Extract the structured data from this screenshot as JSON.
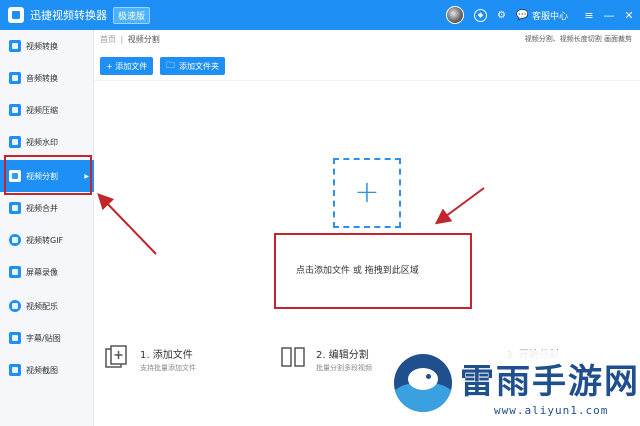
{
  "titlebar": {
    "app_title": "迅捷视频转换器",
    "edition_badge": "极速版",
    "service_label": "客服中心",
    "min_label": "—",
    "close_label": "✕"
  },
  "sidebar": {
    "items": [
      {
        "label": "视频转换"
      },
      {
        "label": "音频转换"
      },
      {
        "label": "视频压缩"
      },
      {
        "label": "视频水印"
      },
      {
        "label": "视频分割"
      },
      {
        "label": "视频合并"
      },
      {
        "label": "视频转GIF"
      },
      {
        "label": "屏幕录像"
      },
      {
        "label": "视频配乐"
      },
      {
        "label": "字幕/贴图"
      },
      {
        "label": "视频截图"
      }
    ],
    "active_index": 4
  },
  "breadcrumb": {
    "home": "首页",
    "sep": "|",
    "current": "视频分割"
  },
  "topright": "视频分割、视频长度切割 画面裁剪",
  "toolbar": {
    "add_file": "+ 添加文件",
    "add_folder": "添加文件夹"
  },
  "dropzone": {
    "hint": "点击添加文件 或 拖拽到此区域"
  },
  "steps": [
    {
      "title": "1. 添加文件",
      "desc": "支持批量添加文件"
    },
    {
      "title": "2. 编辑分割",
      "desc": "批量分割多段视频"
    },
    {
      "title": "3. 开始分割",
      "desc": ""
    }
  ],
  "watermark": {
    "brand": "雷雨手游网",
    "url": "www.aliyun1.com"
  },
  "colors": {
    "brand_blue": "#1e8ff5",
    "annotation_red": "#c0262c"
  }
}
